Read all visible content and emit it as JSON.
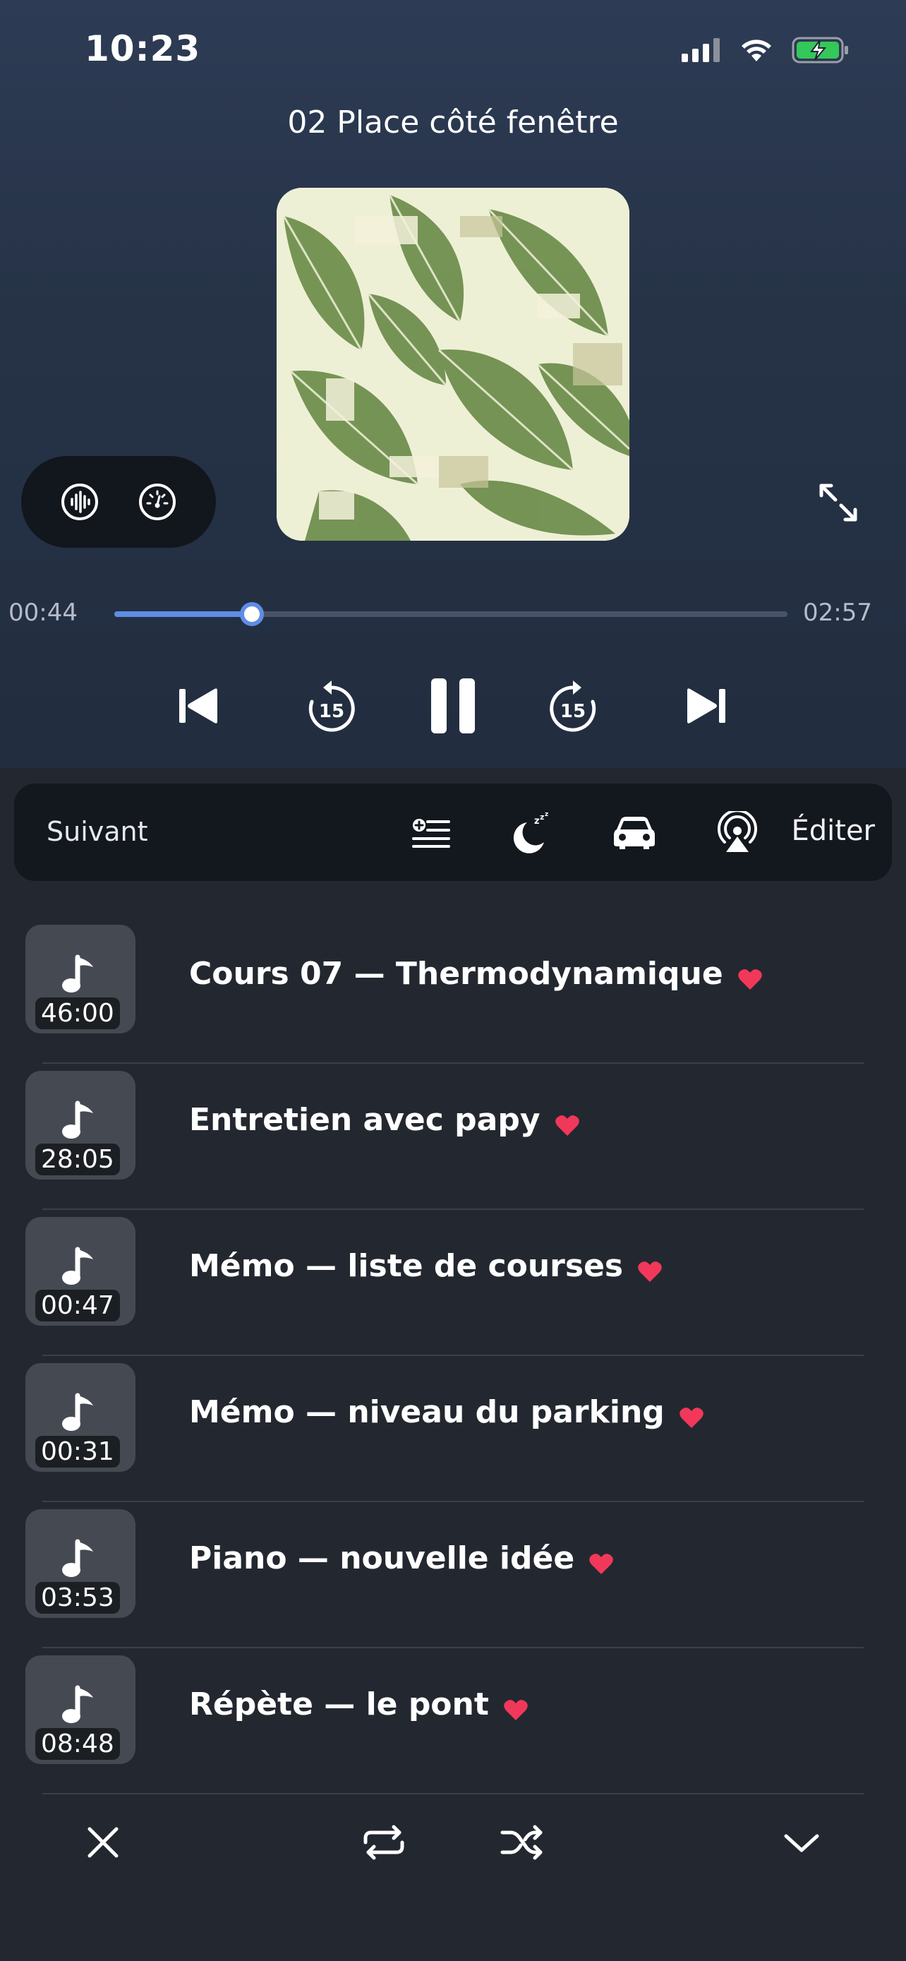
{
  "status_bar": {
    "time": "10:23",
    "icons": [
      "cellular-signal-icon",
      "wifi-icon",
      "battery-charging-icon"
    ]
  },
  "now_playing": {
    "title": "02 Place côté fenêtre",
    "artwork": "leaf-pattern-artwork",
    "elapsed": "00:44",
    "duration": "02:57",
    "progress": 0.204,
    "left_pill_icons": [
      "waveform-icon",
      "speedometer-icon"
    ],
    "expand_icon": "expand-arrows-icon"
  },
  "controls": {
    "previous": "skip-previous-icon",
    "rewind": {
      "icon": "rewind-15-icon",
      "label": "15"
    },
    "play_pause": "pause-icon",
    "forward": {
      "icon": "forward-15-icon",
      "label": "15"
    },
    "next": "skip-next-icon"
  },
  "queue_header": {
    "label": "Suivant",
    "icons": [
      "add-to-queue-icon",
      "sleep-timer-icon",
      "car-icon",
      "airplay-icon"
    ],
    "edit_label": "Éditer"
  },
  "queue": [
    {
      "title": "Cours 07 — Thermodynamique",
      "duration": "46:00",
      "favorite": true
    },
    {
      "title": "Entretien avec papy",
      "duration": "28:05",
      "favorite": true
    },
    {
      "title": "Mémo — liste de courses",
      "duration": "00:47",
      "favorite": true
    },
    {
      "title": "Mémo — niveau du parking",
      "duration": "00:31",
      "favorite": true
    },
    {
      "title": "Piano — nouvelle idée",
      "duration": "03:53",
      "favorite": true
    },
    {
      "title": "Répète — le pont",
      "duration": "08:48",
      "favorite": true
    }
  ],
  "bottom_bar": {
    "icons": [
      "close-icon",
      "repeat-icon",
      "shuffle-icon",
      "chevron-down-icon"
    ]
  },
  "colors": {
    "accent": "#5e8de6",
    "heart": "#f2385a",
    "background": "#232830"
  }
}
